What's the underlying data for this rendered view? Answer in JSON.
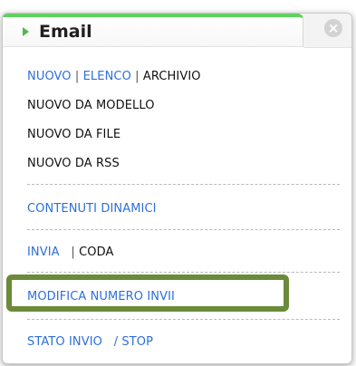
{
  "header": {
    "title": "Email",
    "close_label": "×"
  },
  "menu": {
    "row1": {
      "nuovo": "NUOVO",
      "sep1": "|",
      "elenco": "ELENCO",
      "sep2": "|",
      "archivio": "ARCHIVIO"
    },
    "nuovo_da_modello": "NUOVO DA MODELLO",
    "nuovo_da_file": "NUOVO DA FILE",
    "nuovo_da_rss": "NUOVO DA RSS",
    "contenuti_dinamici": "CONTENUTI DINAMICI",
    "invia_row": {
      "invia": "INVIA",
      "sep": "|",
      "coda": "CODA"
    },
    "modifica_numero_invii": "MODIFICA NUMERO INVII",
    "stato_row": {
      "stato_invio": "STATO INVIO",
      "stop": "/ STOP"
    }
  },
  "colors": {
    "accent_green": "#5fd25f",
    "link_blue": "#2e6fd8",
    "highlight_border": "#6b8a3a"
  }
}
